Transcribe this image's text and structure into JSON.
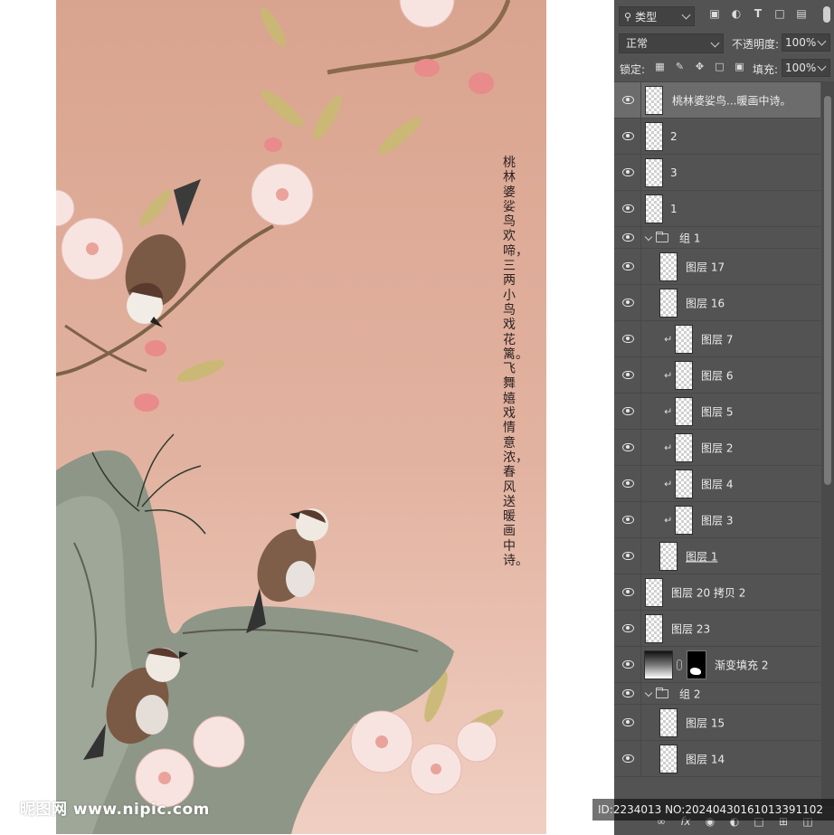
{
  "artwork": {
    "poem": "桃林婆娑鸟欢啼，三两小鸟戏花篱。飞舞嬉戏情意浓，春风送暖画中诗。",
    "watermark": "昵图网 www.nipic.com"
  },
  "panel": {
    "kind_label": "类型",
    "filter_icons": [
      "image-filter-icon",
      "adjustment-filter-icon",
      "type-filter-icon",
      "shape-filter-icon",
      "smart-object-filter-icon"
    ],
    "blend_mode": "正常",
    "opacity_label": "不透明度:",
    "opacity_value": "100%",
    "lock_label": "锁定:",
    "lock_icons": [
      "lock-transparent-icon",
      "lock-image-icon",
      "lock-position-icon",
      "lock-artboard-icon",
      "lock-all-icon"
    ],
    "fill_label": "填充:",
    "fill_value": "100%",
    "layers": [
      {
        "name": "桃林婆娑鸟...暖画中诗。",
        "type": "text",
        "selected": true,
        "indent": 0
      },
      {
        "name": "2",
        "type": "pixel",
        "indent": 0
      },
      {
        "name": "3",
        "type": "pixel",
        "indent": 0
      },
      {
        "name": "1",
        "type": "pixel",
        "indent": 0
      },
      {
        "name": "组 1",
        "type": "group",
        "expanded": true,
        "indent": 0
      },
      {
        "name": "图层 17",
        "type": "pixel",
        "indent": 1
      },
      {
        "name": "图层 16",
        "type": "pixel",
        "indent": 1
      },
      {
        "name": "图层 7",
        "type": "pixel",
        "indent": 2,
        "clipped": true
      },
      {
        "name": "图层 6",
        "type": "pixel",
        "indent": 2,
        "clipped": true
      },
      {
        "name": "图层 5",
        "type": "pixel",
        "indent": 2,
        "clipped": true
      },
      {
        "name": "图层 2",
        "type": "pixel",
        "indent": 2,
        "clipped": true
      },
      {
        "name": "图层 4",
        "type": "pixel",
        "indent": 2,
        "clipped": true
      },
      {
        "name": "图层 3",
        "type": "pixel",
        "indent": 2,
        "clipped": true
      },
      {
        "name": "图层 1",
        "type": "pixel",
        "indent": 1
      },
      {
        "name": "图层 20 拷贝 2",
        "type": "pixel",
        "indent": 0
      },
      {
        "name": "图层 23",
        "type": "pixel",
        "indent": 0
      },
      {
        "name": "渐变填充 2",
        "type": "gradient-fill",
        "indent": 0
      },
      {
        "name": "组 2",
        "type": "group",
        "expanded": true,
        "indent": 0
      },
      {
        "name": "图层 15",
        "type": "pixel",
        "indent": 1
      },
      {
        "name": "图层 14",
        "type": "pixel",
        "indent": 1
      }
    ],
    "bottom_icons": [
      "link-layers-icon",
      "fx-icon",
      "add-mask-icon",
      "adjustment-layer-icon",
      "new-group-icon",
      "new-layer-icon",
      "trash-icon"
    ]
  },
  "id_overlay": "ID:2234013 NO:20240430161013391102"
}
